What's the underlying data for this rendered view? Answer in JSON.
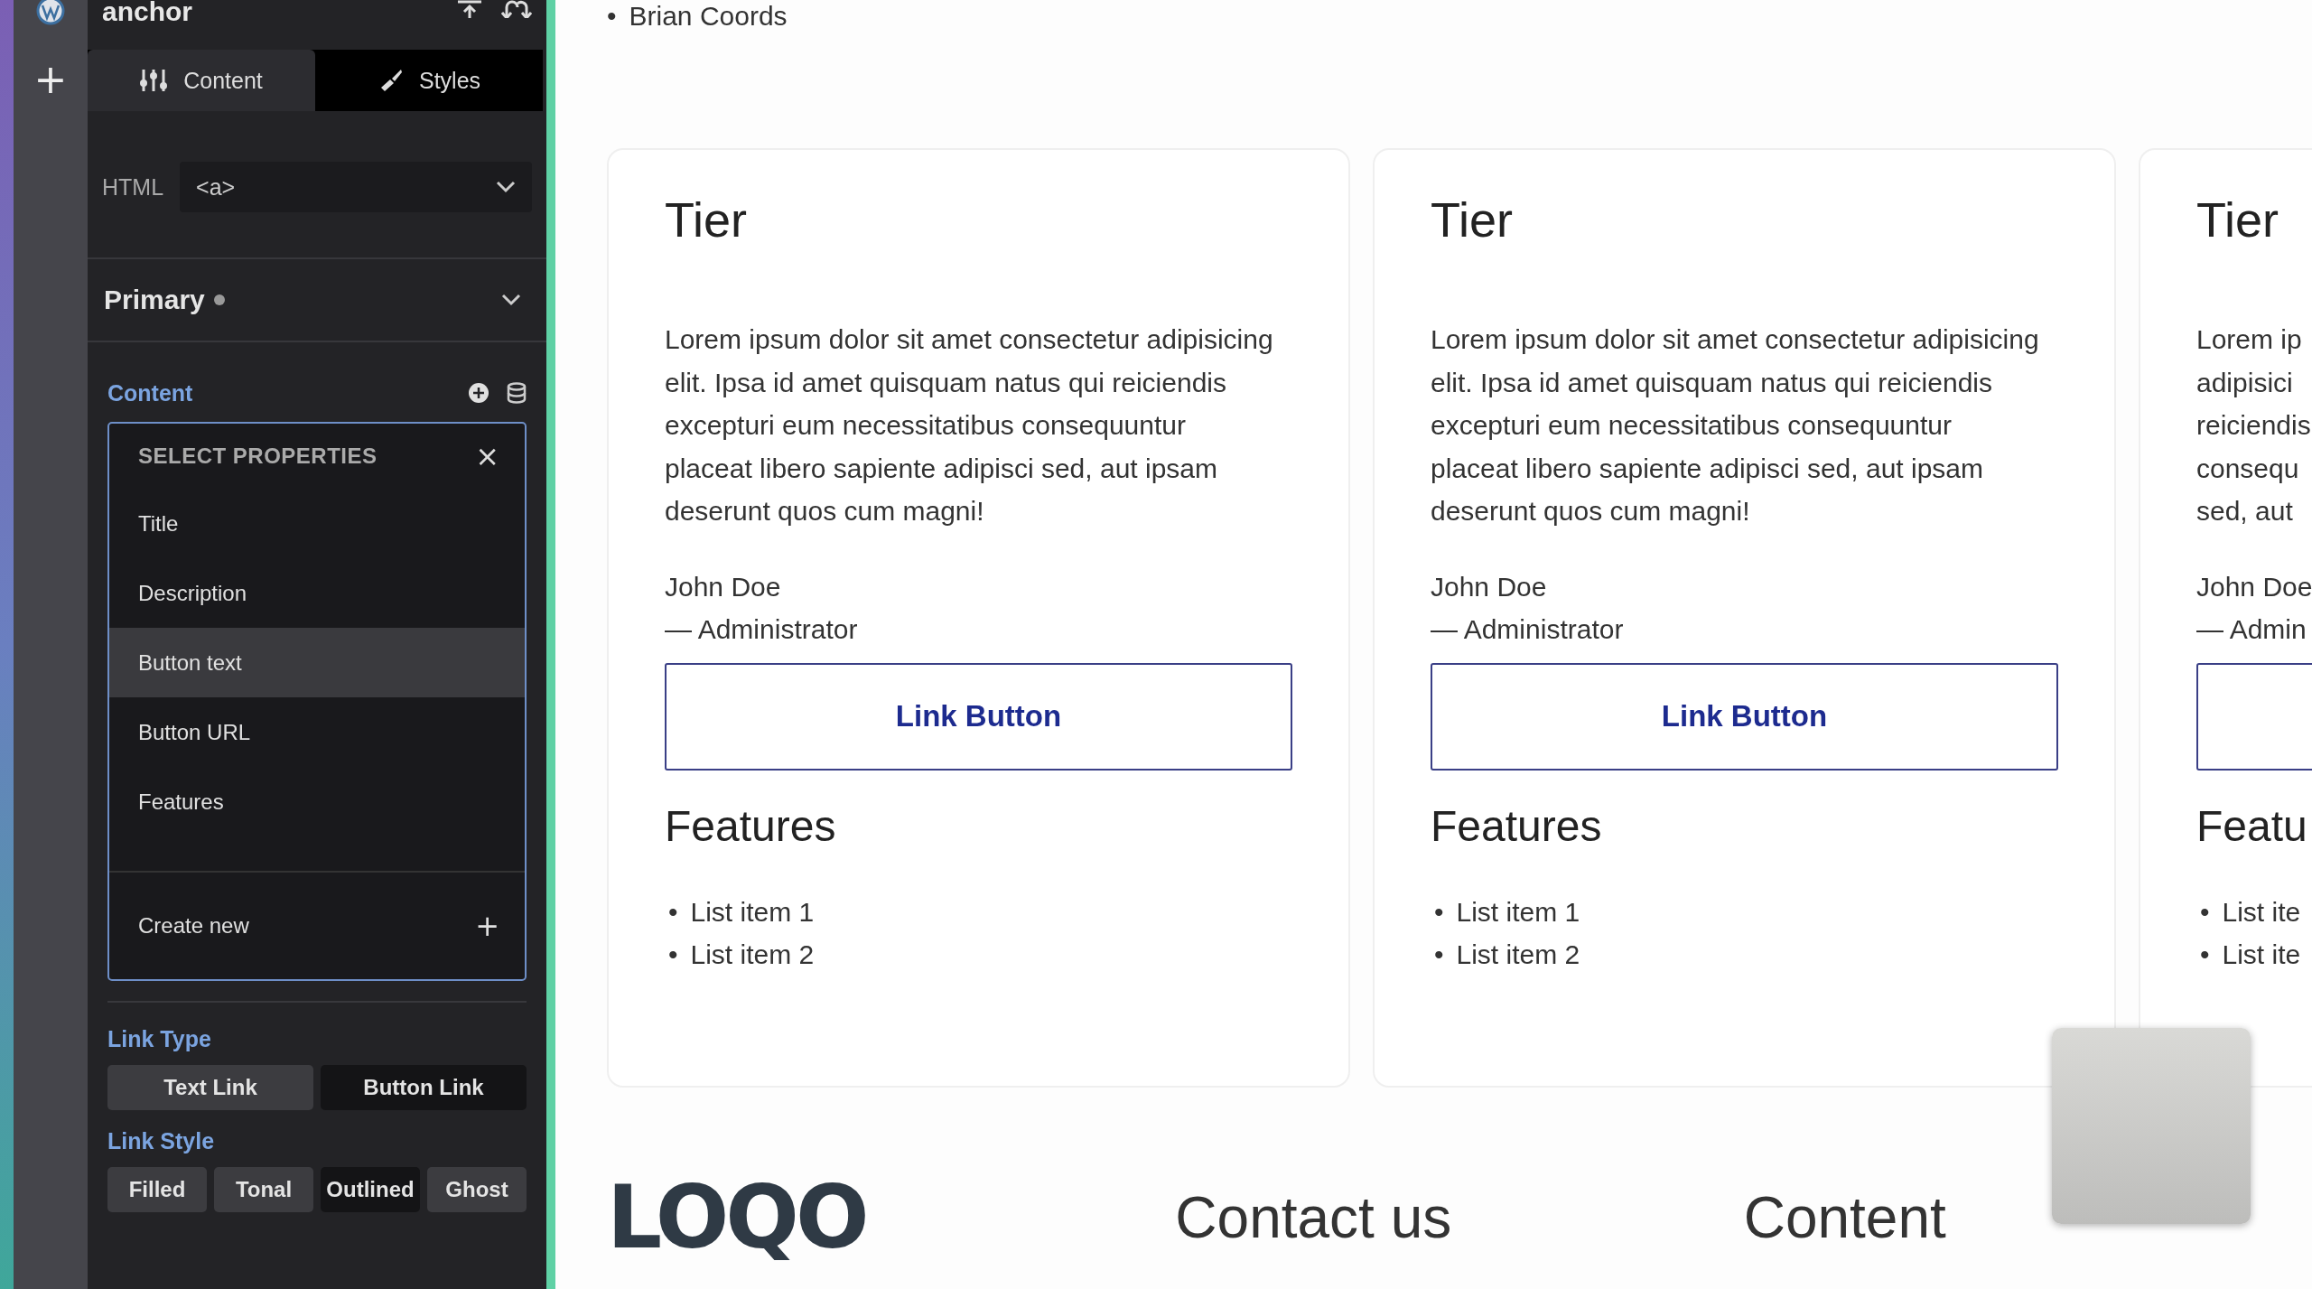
{
  "rail": {
    "add": "+"
  },
  "panel": {
    "title": "anchor",
    "tabs": [
      {
        "label": "Content",
        "kind": "sliders",
        "selected": true
      },
      {
        "label": "Styles",
        "kind": "brush",
        "selected": false
      }
    ],
    "html_field": {
      "label": "HTML",
      "value": "<a>"
    },
    "section": {
      "title": "Primary",
      "expanded": true
    },
    "content": {
      "label": "Content",
      "dropdown": {
        "heading": "SELECT PROPERTIES",
        "close": "×",
        "items": [
          {
            "label": "Title",
            "selected": false
          },
          {
            "label": "Description",
            "selected": false
          },
          {
            "label": "Button text",
            "selected": true
          },
          {
            "label": "Button URL",
            "selected": false
          },
          {
            "label": "Features",
            "selected": false
          }
        ],
        "create": {
          "label": "Create new",
          "icon": "+"
        }
      }
    },
    "link_type": {
      "label": "Link Type",
      "options": [
        {
          "label": "Text Link",
          "selected": false
        },
        {
          "label": "Button Link",
          "selected": true
        }
      ]
    },
    "link_style": {
      "label": "Link Style",
      "options": [
        {
          "label": "Filled",
          "selected": false
        },
        {
          "label": "Tonal",
          "selected": false
        },
        {
          "label": "Outlined",
          "selected": true
        },
        {
          "label": "Ghost",
          "selected": false
        }
      ]
    }
  },
  "page": {
    "bullet": "•",
    "author_list": [
      "Brian Coords"
    ],
    "cards": [
      {
        "title": "Tier",
        "description": [
          "Lorem ipsum dolor sit amet consectetur adipisicing elit. Ipsa id amet quisquam natus qui reiciendis excepturi eum necessitatibus consequuntur placeat libero sapiente adipisci sed, aut ipsam deserunt quos cum magni!"
        ],
        "author": "John Doe",
        "role": "— Administrator",
        "button": "Link Button",
        "features_title": "Features",
        "features": [
          "List item 1",
          "List item 2"
        ]
      },
      {
        "title": "Tier",
        "description": [
          "Lorem ipsum dolor sit amet consectetur adipisicing elit. Ipsa id amet quisquam natus qui reiciendis excepturi eum necessitatibus consequuntur placeat libero sapiente adipisci sed, aut ipsam deserunt quos cum magni!"
        ],
        "author": "John Doe",
        "role": "— Administrator",
        "button": "Link Button",
        "features_title": "Features",
        "features": [
          "List item 1",
          "List item 2"
        ]
      },
      {
        "title": "Tier",
        "description": [
          "Lorem ip",
          "adipisici",
          "reiciendis",
          "consequ",
          "sed, aut"
        ],
        "author": "John Doe",
        "role": "— Admin",
        "features_title": "Featu",
        "features": [
          "List ite",
          "List ite"
        ]
      }
    ],
    "footer": {
      "logo": "LOQO",
      "columns": [
        "Contact us",
        "Content"
      ]
    }
  }
}
